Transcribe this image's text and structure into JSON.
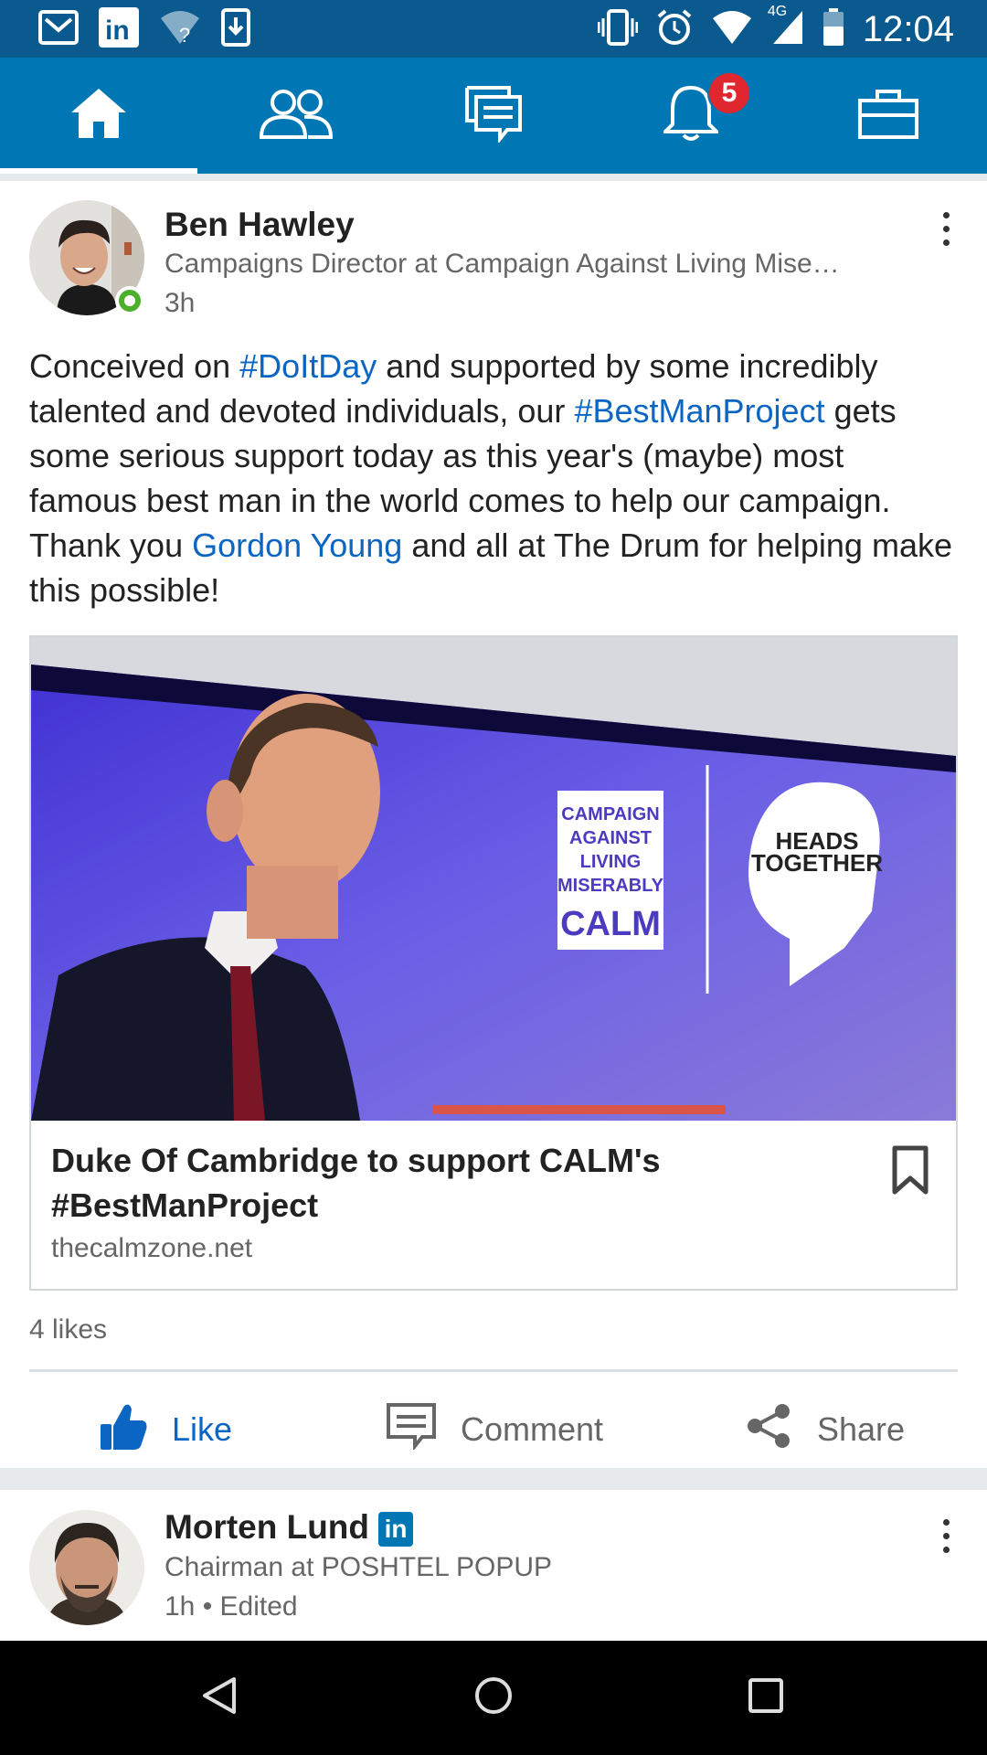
{
  "status_bar": {
    "time": "12:04",
    "network": "4G",
    "left_icons": [
      "gmail-icon",
      "linkedin-icon",
      "wifi-question-icon",
      "download-icon"
    ],
    "right_icons": [
      "vibrate-icon",
      "alarm-icon",
      "wifi-icon",
      "signal-icon",
      "battery-icon"
    ]
  },
  "nav": {
    "items": [
      {
        "name": "home",
        "icon": "home-icon",
        "active": true
      },
      {
        "name": "my-network",
        "icon": "people-icon",
        "active": false
      },
      {
        "name": "messaging",
        "icon": "messages-icon",
        "active": false
      },
      {
        "name": "notifications",
        "icon": "bell-icon",
        "active": false,
        "badge": "5"
      },
      {
        "name": "jobs",
        "icon": "briefcase-icon",
        "active": false
      }
    ],
    "notification_badge": "5"
  },
  "post1": {
    "author": "Ben Hawley",
    "title": "Campaigns Director at Campaign Against Living Mise…",
    "time": "3h",
    "text": {
      "p1": "Conceived on ",
      "tag1": "#DoItDay",
      "p2": " and supported by some incredibly talented and devoted individuals, our ",
      "tag2": "#BestManProject",
      "p3": " gets some serious support today as this year's (maybe) most famous best man in the world comes to help our campaign. Thank you ",
      "mention": "Gordon Young",
      "p4": " and all at The Drum for helping make this possible!"
    },
    "article": {
      "calm_logo": [
        "CAMPAIGN",
        "AGAINST",
        "LIVING",
        "MISERABLY",
        "CALM"
      ],
      "heads_together_logo": [
        "HEADS",
        "TOGETHER"
      ],
      "title": "Duke Of Cambridge to support CALM's #BestManProject",
      "domain": "thecalmzone.net"
    },
    "likes": "4 likes",
    "actions": {
      "like": "Like",
      "comment": "Comment",
      "share": "Share"
    }
  },
  "post2": {
    "author": "Morten Lund",
    "in_badge": "in",
    "title": "Chairman at POSHTEL POPUP",
    "time": "1h • Edited"
  },
  "colors": {
    "nav_blue": "#0077b5",
    "status_blue": "#0a5a8f",
    "link_blue": "#0a66c2",
    "badge_red": "#e0262e",
    "online_green": "#4caf2a"
  }
}
